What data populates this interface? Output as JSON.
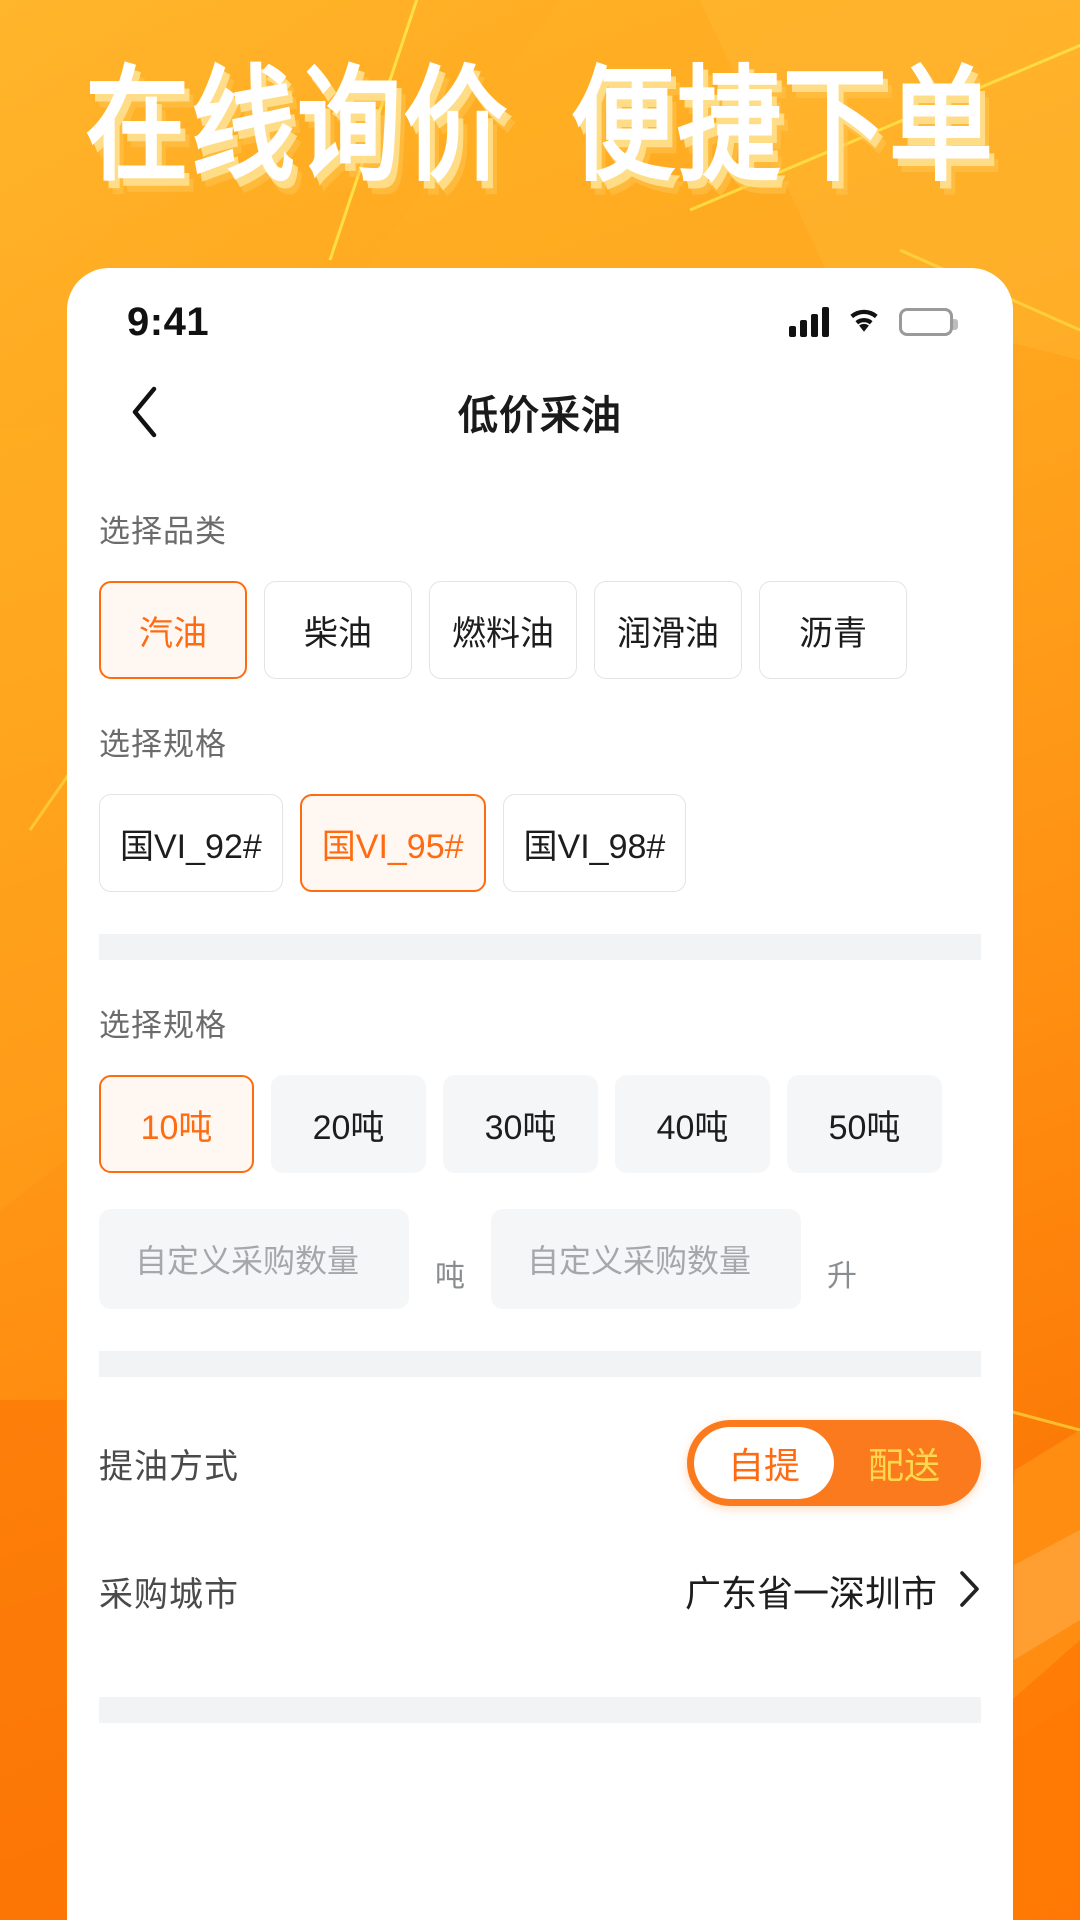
{
  "hero": {
    "line1": "在线询价  便捷下单"
  },
  "status_bar": {
    "time": "9:41",
    "signal_icon": "signal-bars-icon",
    "wifi_icon": "wifi-icon",
    "battery_icon": "battery-icon"
  },
  "nav": {
    "back_icon": "chevron-left-icon",
    "title": "低价采油"
  },
  "category_section": {
    "label": "选择品类",
    "options": [
      {
        "label": "汽油",
        "selected": true
      },
      {
        "label": "柴油",
        "selected": false
      },
      {
        "label": "燃料油",
        "selected": false
      },
      {
        "label": "润滑油",
        "selected": false
      },
      {
        "label": "沥青",
        "selected": false
      }
    ]
  },
  "spec_section": {
    "label": "选择规格",
    "options": [
      {
        "label": "国VI_92#",
        "selected": false
      },
      {
        "label": "国VI_95#",
        "selected": true
      },
      {
        "label": "国VI_98#",
        "selected": false
      }
    ]
  },
  "quantity_section": {
    "label": "选择规格",
    "options": [
      {
        "label": "10吨",
        "selected": true
      },
      {
        "label": "20吨",
        "selected": false
      },
      {
        "label": "30吨",
        "selected": false
      },
      {
        "label": "40吨",
        "selected": false
      },
      {
        "label": "50吨",
        "selected": false
      }
    ],
    "custom_ton": {
      "placeholder": "自定义采购数量",
      "value": "",
      "unit": "吨"
    },
    "custom_liter": {
      "placeholder": "自定义采购数量",
      "value": "",
      "unit": "升"
    }
  },
  "delivery_row": {
    "label": "提油方式",
    "options": [
      {
        "label": "自提",
        "selected": true
      },
      {
        "label": "配送",
        "selected": false
      }
    ]
  },
  "city_row": {
    "label": "采购城市",
    "value": "广东省一深圳市",
    "chevron_icon": "chevron-right-icon"
  },
  "colors": {
    "accent": "#FF6B11",
    "accent_soft": "#FFF7F1",
    "toggle_bg": "#FB7A1E",
    "toggle_inactive_text": "#FFD84D",
    "chip_fill": "#f5f6f7",
    "separator": "#f1f3f4",
    "bg_orange_top": "#FFB326",
    "bg_orange_bottom": "#F96C00"
  }
}
